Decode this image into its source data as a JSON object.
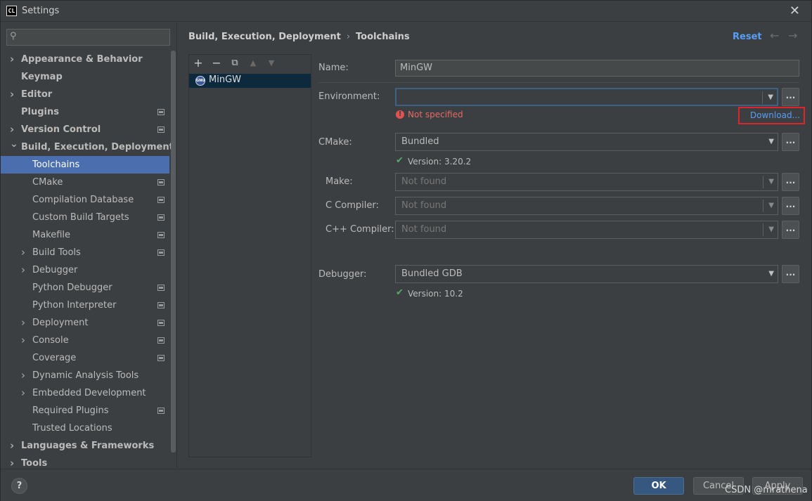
{
  "window": {
    "title": "Settings",
    "app_icon": "CL"
  },
  "search": {
    "placeholder": "",
    "icon": "search-icon"
  },
  "sidebar": {
    "items": [
      {
        "label": "Appearance & Behavior",
        "level": 0,
        "bold": true,
        "expandable": true,
        "expanded": false,
        "project_badge": false
      },
      {
        "label": "Keymap",
        "level": 0,
        "bold": true,
        "expandable": false,
        "project_badge": false
      },
      {
        "label": "Editor",
        "level": 0,
        "bold": true,
        "expandable": true,
        "expanded": false,
        "project_badge": false
      },
      {
        "label": "Plugins",
        "level": 0,
        "bold": true,
        "expandable": false,
        "project_badge": true
      },
      {
        "label": "Version Control",
        "level": 0,
        "bold": true,
        "expandable": true,
        "expanded": false,
        "project_badge": true
      },
      {
        "label": "Build, Execution, Deployment",
        "level": 0,
        "bold": true,
        "expandable": true,
        "expanded": true,
        "project_badge": false
      },
      {
        "label": "Toolchains",
        "level": 1,
        "bold": false,
        "expandable": false,
        "project_badge": false,
        "selected": true
      },
      {
        "label": "CMake",
        "level": 1,
        "bold": false,
        "expandable": false,
        "project_badge": true
      },
      {
        "label": "Compilation Database",
        "level": 1,
        "bold": false,
        "expandable": false,
        "project_badge": true
      },
      {
        "label": "Custom Build Targets",
        "level": 1,
        "bold": false,
        "expandable": false,
        "project_badge": true
      },
      {
        "label": "Makefile",
        "level": 1,
        "bold": false,
        "expandable": false,
        "project_badge": true
      },
      {
        "label": "Build Tools",
        "level": 1,
        "bold": false,
        "expandable": true,
        "expanded": false,
        "project_badge": true
      },
      {
        "label": "Debugger",
        "level": 1,
        "bold": false,
        "expandable": true,
        "expanded": false,
        "project_badge": false
      },
      {
        "label": "Python Debugger",
        "level": 1,
        "bold": false,
        "expandable": false,
        "project_badge": true
      },
      {
        "label": "Python Interpreter",
        "level": 1,
        "bold": false,
        "expandable": false,
        "project_badge": true
      },
      {
        "label": "Deployment",
        "level": 1,
        "bold": false,
        "expandable": true,
        "expanded": false,
        "project_badge": true
      },
      {
        "label": "Console",
        "level": 1,
        "bold": false,
        "expandable": true,
        "expanded": false,
        "project_badge": true
      },
      {
        "label": "Coverage",
        "level": 1,
        "bold": false,
        "expandable": false,
        "project_badge": true
      },
      {
        "label": "Dynamic Analysis Tools",
        "level": 1,
        "bold": false,
        "expandable": true,
        "expanded": false,
        "project_badge": false
      },
      {
        "label": "Embedded Development",
        "level": 1,
        "bold": false,
        "expandable": true,
        "expanded": false,
        "project_badge": false
      },
      {
        "label": "Required Plugins",
        "level": 1,
        "bold": false,
        "expandable": false,
        "project_badge": true
      },
      {
        "label": "Trusted Locations",
        "level": 1,
        "bold": false,
        "expandable": false,
        "project_badge": false
      },
      {
        "label": "Languages & Frameworks",
        "level": 0,
        "bold": true,
        "expandable": true,
        "expanded": false,
        "project_badge": false
      },
      {
        "label": "Tools",
        "level": 0,
        "bold": true,
        "expandable": true,
        "expanded": false,
        "project_badge": false
      }
    ]
  },
  "breadcrumb": {
    "parent": "Build, Execution, Deployment",
    "separator": "›",
    "current": "Toolchains"
  },
  "header": {
    "reset_label": "Reset",
    "back_arrow": "←",
    "forward_arrow": "→"
  },
  "toolchain_list": {
    "toolbar": {
      "add": "+",
      "remove": "−",
      "copy": "⧉",
      "up": "▲",
      "down": "▼"
    },
    "items": [
      {
        "label": "MinGW",
        "icon_text": "GNU"
      }
    ]
  },
  "form": {
    "name_label": "Name:",
    "name_value": "MinGW",
    "environment_label": "Environment:",
    "environment_value": "",
    "environment_error": "Not specified",
    "download_label": "Download...",
    "cmake_label": "CMake:",
    "cmake_value": "Bundled",
    "cmake_version": "Version: 3.20.2",
    "make_label": "Make:",
    "make_value": "Not found",
    "c_compiler_label": "C Compiler:",
    "c_compiler_value": "Not found",
    "cpp_compiler_label": "C++ Compiler:",
    "cpp_compiler_value": "Not found",
    "debugger_label": "Debugger:",
    "debugger_value": "Bundled GDB",
    "debugger_version": "Version: 10.2",
    "dots": "...",
    "dropdown_arrow": "▼",
    "check": "✔",
    "error_mark": "!"
  },
  "footer": {
    "help": "?",
    "ok_label": "OK",
    "cancel_label": "Cancel",
    "apply_label": "Apply",
    "watermark": "CSDN @mrathena"
  },
  "colors": {
    "background": "#3c3f41",
    "selection": "#4b6eaf",
    "link": "#589df6",
    "error": "#e86866",
    "success": "#59a869",
    "primary_button": "#365880",
    "highlight_box": "#e0242b"
  }
}
